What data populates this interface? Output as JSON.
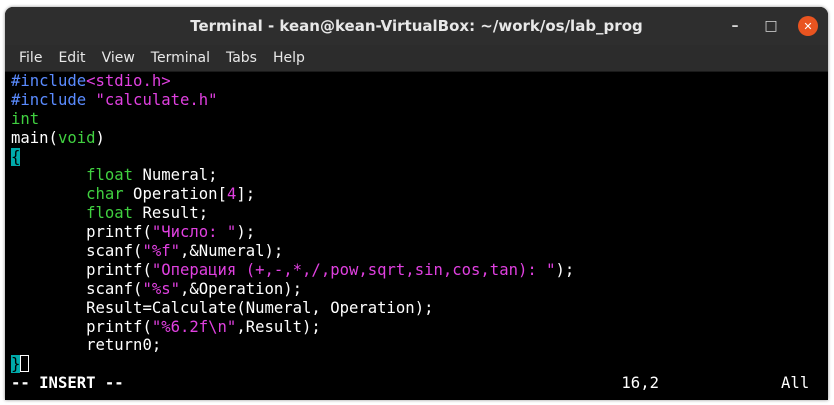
{
  "window": {
    "title": "Terminal - kean@kean-VirtualBox: ~/work/os/lab_prog"
  },
  "menu": [
    "File",
    "Edit",
    "View",
    "Terminal",
    "Tabs",
    "Help"
  ],
  "editor": {
    "line1": {
      "a": "#include",
      "b": "<stdio.h>"
    },
    "line2": {
      "a": "#include ",
      "b": "\"calculate.h\""
    },
    "line3": "int",
    "line4": {
      "a": "main(",
      "b": "void",
      "c": ")"
    },
    "line5": "{",
    "line6": {
      "a": "float",
      "b": " Numeral;"
    },
    "line7": {
      "a": "char",
      "b": " Operation[",
      "c": "4",
      "d": "];"
    },
    "line8": {
      "a": "float",
      "b": " Result;"
    },
    "line9": {
      "a": "printf(",
      "b": "\"Число: \"",
      "c": ");"
    },
    "line10": {
      "a": "scanf(",
      "b": "\"%f\"",
      "c": ",&Numeral);"
    },
    "line11": {
      "a": "printf(",
      "b": "\"Операция (+,-,*,/,pow,sqrt,sin,cos,tan): \"",
      "c": ");"
    },
    "line12": {
      "a": "scanf(",
      "b": "\"%s\"",
      "c": ",&Operation);"
    },
    "line13": "Result=Calculate(Numeral, Operation);",
    "line14": {
      "a": "printf(",
      "b": "\"%6.2f\\n\"",
      "c": ",Result);"
    },
    "line15": "return0;",
    "line16": "}"
  },
  "status": {
    "mode": "-- INSERT --",
    "position": "16,2",
    "scroll": "All"
  }
}
